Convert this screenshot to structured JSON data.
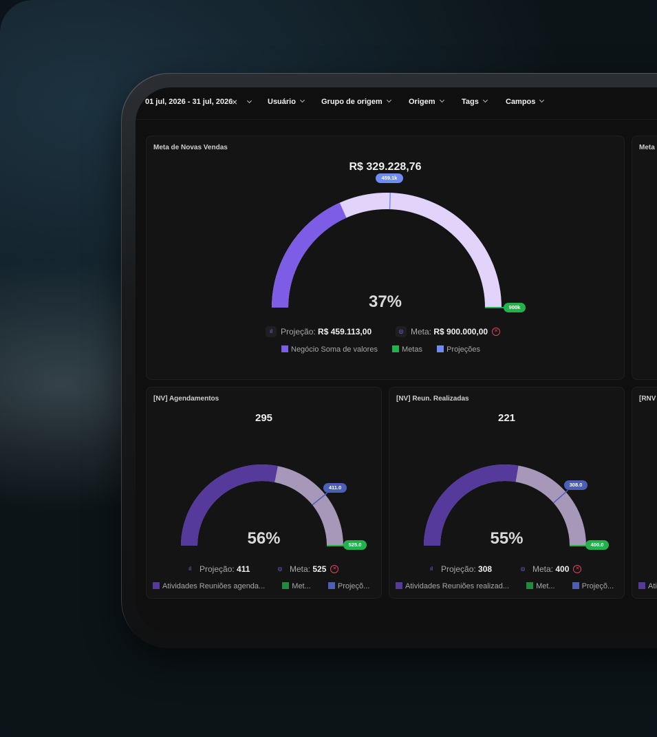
{
  "filters": {
    "date_range": "01 jul, 2026 - 31 jul, 2026",
    "user": "Usuário",
    "origin_group": "Grupo de origem",
    "origin": "Origem",
    "tags": "Tags",
    "fields": "Campos"
  },
  "main_card": {
    "title": "Meta de Novas Vendas",
    "value": "R$ 329.228,76",
    "percent": "37%",
    "projection_pill": "459.1k",
    "goal_pill": "900k",
    "projection_label": "Projeção:",
    "projection_value": "R$ 459.113,00",
    "goal_label": "Meta:",
    "goal_value": "R$ 900.000,00",
    "legend": [
      "Negócio Soma de valores",
      "Metas",
      "Projeções"
    ],
    "progress_fraction": 0.366,
    "projection_fraction": 0.51,
    "colors": {
      "progress": "#7d5ce6",
      "projection": "#e2d3fb",
      "goal": "#22b14c",
      "projection_marker": "#6f8cf4"
    }
  },
  "cards": [
    {
      "title": "[NV] Agendamentos",
      "value": "295",
      "percent": "56%",
      "projection_pill": "411.0",
      "goal_pill": "525.0",
      "projection_label": "Projeção:",
      "projection_value": "411",
      "goal_label": "Meta:",
      "goal_value": "525",
      "legend": [
        "Atividades Reuniões agenda...",
        "Met...",
        "Projeçõ..."
      ],
      "progress_fraction": 0.562,
      "projection_fraction": 0.783
    },
    {
      "title": "[NV] Reun. Realizadas",
      "value": "221",
      "percent": "55%",
      "projection_pill": "308.0",
      "goal_pill": "400.0",
      "projection_label": "Projeção:",
      "projection_value": "308",
      "goal_label": "Meta:",
      "goal_value": "400",
      "legend": [
        "Atividades Reuniões realizad...",
        "Met...",
        "Projeçõ..."
      ],
      "progress_fraction": 0.553,
      "projection_fraction": 0.77
    }
  ],
  "partial_cards": {
    "right_top_title": "Meta",
    "right_bottom_title": "[RNV",
    "right_bottom_legend": "Ati"
  },
  "small_colors": {
    "progress": "#55399b",
    "projection": "#a797b9",
    "goal": "#22b14c",
    "projection_marker": "#4c5eb6",
    "pill": "#4c5eb6"
  }
}
